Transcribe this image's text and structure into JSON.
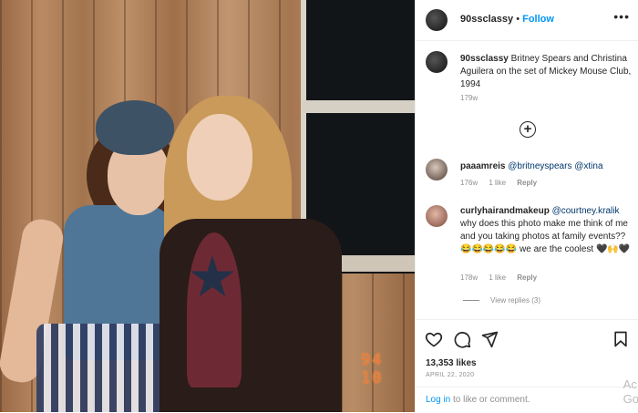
{
  "header": {
    "username": "90ssclassy",
    "separator": "•",
    "follow_label": "Follow",
    "more_label": "•••"
  },
  "caption": {
    "username": "90ssclassy",
    "text": "Britney Spears and Christina Aguilera on the set of Mickey Mouse Club, 1994",
    "time": "179w"
  },
  "photo": {
    "date_stamp": "94 10"
  },
  "load_more_label": "+",
  "comments": [
    {
      "username": "paaamreis",
      "mention1": "@britneyspears",
      "mention2": "@xtina",
      "time": "176w",
      "likes": "1 like",
      "reply": "Reply"
    },
    {
      "username": "curlyhairandmakeup",
      "mention": "@courtney.kralik",
      "text": "why does this photo make me think of me and you taking photos at family events?? 😂😂😂😂😂 we are the coolest 🖤🙌🖤",
      "time": "178w",
      "likes": "1 like",
      "reply": "Reply",
      "view_replies": "View replies (3)"
    }
  ],
  "likes": "13,353 likes",
  "date": "APRIL 22, 2020",
  "add_comment": {
    "login": "Log in",
    "rest": " to like or comment."
  },
  "overlay": {
    "line1": "Ac",
    "line2": "Go"
  },
  "colors": {
    "link": "#0095f6",
    "mention": "#00376b",
    "muted": "#8e8e8e"
  }
}
